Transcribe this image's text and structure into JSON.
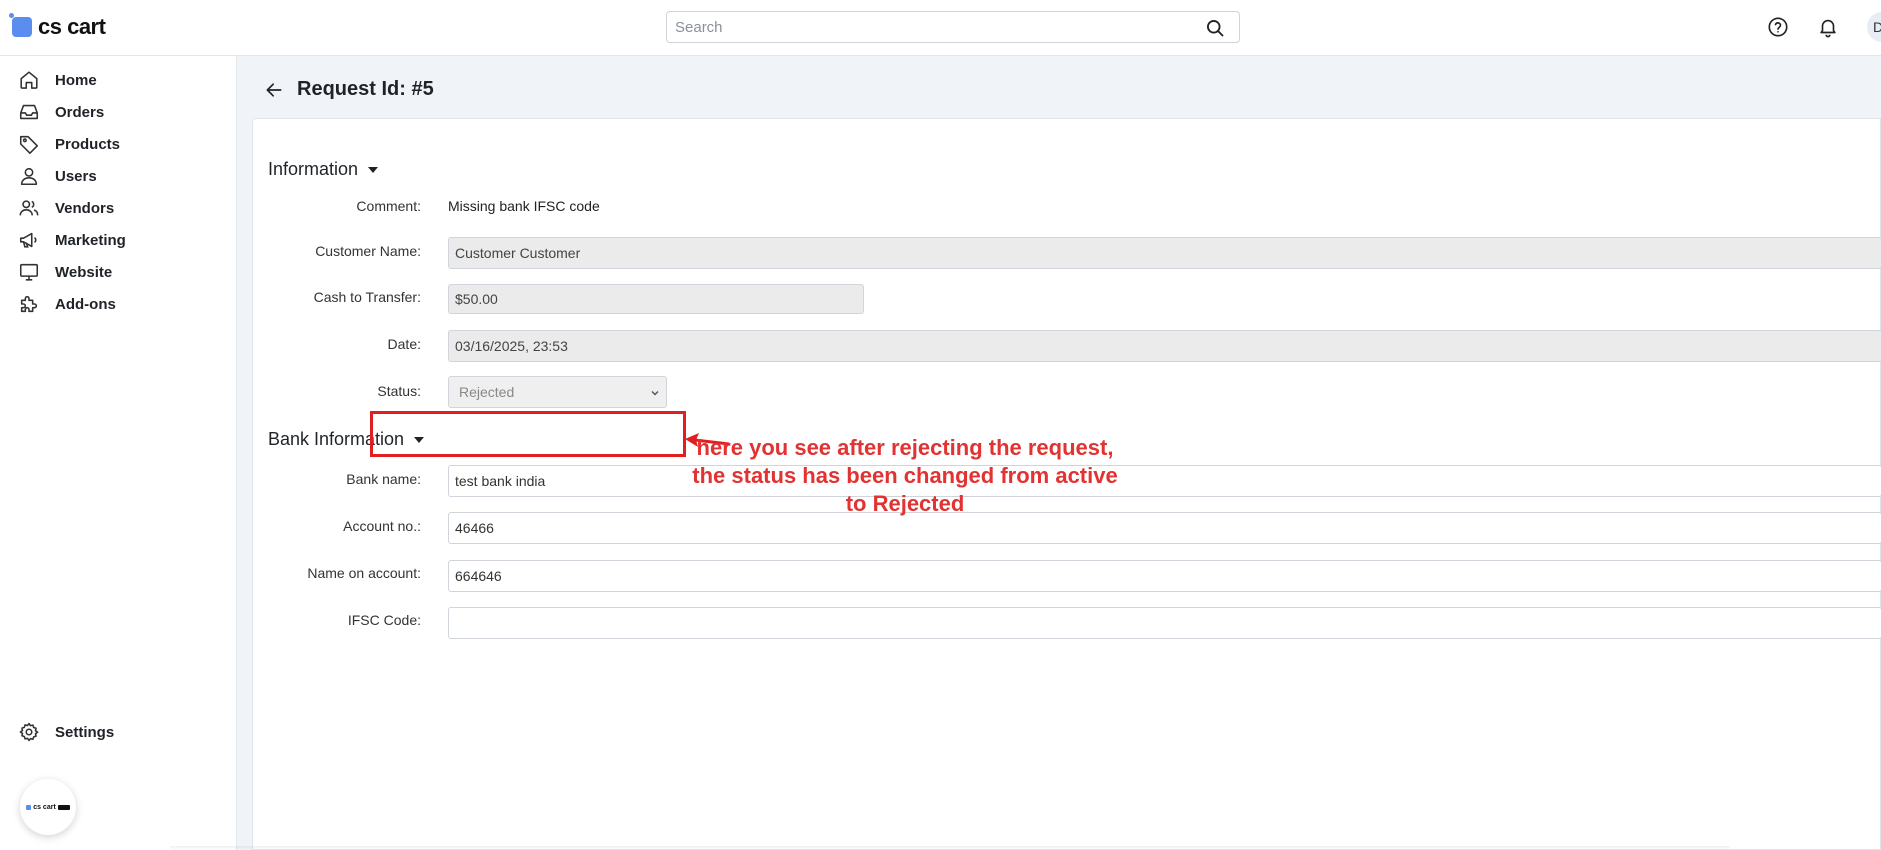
{
  "header": {
    "logo_text": "cs cart",
    "search_placeholder": "Search",
    "avatar_initial": "D"
  },
  "sidebar": {
    "items": [
      {
        "label": "Home",
        "icon": "home-icon"
      },
      {
        "label": "Orders",
        "icon": "inbox-icon"
      },
      {
        "label": "Products",
        "icon": "tag-icon"
      },
      {
        "label": "Users",
        "icon": "user-icon"
      },
      {
        "label": "Vendors",
        "icon": "users-icon"
      },
      {
        "label": "Marketing",
        "icon": "megaphone-icon"
      },
      {
        "label": "Website",
        "icon": "monitor-icon"
      },
      {
        "label": "Add-ons",
        "icon": "puzzle-icon"
      }
    ],
    "settings_label": "Settings",
    "badge_text": "cs cart"
  },
  "page": {
    "title": "Request Id: #5"
  },
  "information": {
    "title": "Information",
    "comment_label": "Comment:",
    "comment_value": "Missing bank IFSC code",
    "customer_label": "Customer Name:",
    "customer_value": "Customer Customer",
    "cash_label": "Cash to Transfer:",
    "cash_value": "$50.00",
    "date_label": "Date:",
    "date_value": "03/16/2025, 23:53",
    "status_label": "Status:",
    "status_value": "Rejected"
  },
  "bank": {
    "title": "Bank Information",
    "bank_name_label": "Bank name:",
    "bank_name_value": "test bank india",
    "account_label": "Account no.:",
    "account_value": "46466",
    "name_label": "Name on account:",
    "name_value": "664646",
    "ifsc_label": "IFSC Code:",
    "ifsc_value": ""
  },
  "annotation": {
    "text": "here you see after rejecting the request, the status has been changed from active to Rejected",
    "color": "#e23232"
  }
}
